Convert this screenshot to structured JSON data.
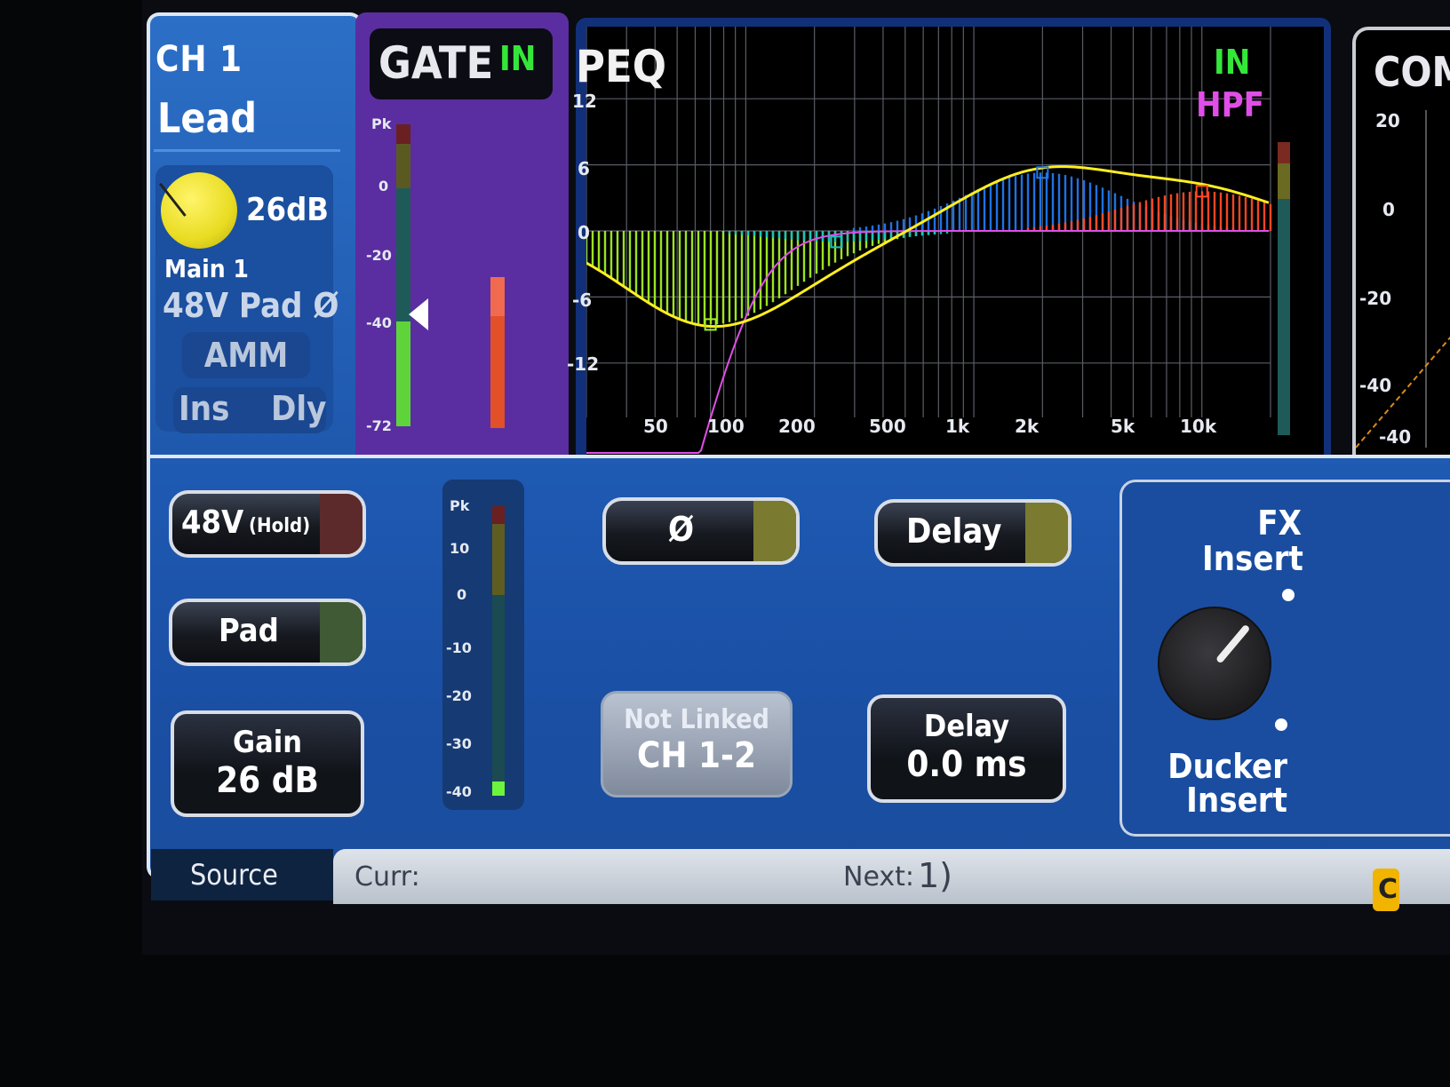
{
  "channel": {
    "id": "CH 1",
    "name": "Lead",
    "gain_readout": "26dB",
    "output": "Main 1",
    "flags": "48V Pad Ø",
    "amm_label": "AMM",
    "ins_label": "Ins",
    "dly_label": "Dly"
  },
  "gate": {
    "title": "GATE",
    "status": "IN",
    "scale": [
      "Pk",
      "0",
      "-20",
      "-40",
      "-72"
    ]
  },
  "peq": {
    "title": "PEQ",
    "status": "IN",
    "hpf_label": "HPF",
    "y_ticks": [
      "12",
      "6",
      "0",
      "-6",
      "-12"
    ],
    "x_ticks": [
      "50",
      "100",
      "200",
      "500",
      "1k",
      "2k",
      "5k",
      "10k"
    ],
    "x_tick_freqs": [
      50,
      100,
      200,
      500,
      1000,
      2000,
      5000,
      10000
    ],
    "band_colors": {
      "band1": "#a4ef23",
      "band2": "#11c6c2",
      "band3": "#1f79f0",
      "band4": "#ff4a25",
      "curve": "#ffee22",
      "hpf": "#e04ee8"
    }
  },
  "comp": {
    "title": "COM",
    "scale": [
      "20",
      "0",
      "-20",
      "-40",
      "-40"
    ]
  },
  "preamp": {
    "phantom_label": "48V",
    "phantom_hint": "(Hold)",
    "pad_label": "Pad",
    "gain_title": "Gain",
    "gain_value": "26 dB",
    "meter_scale": [
      "Pk",
      "10",
      "0",
      "-10",
      "-20",
      "-30",
      "-40"
    ]
  },
  "controls": {
    "polarity_label": "Ø",
    "delay_toggle_label": "Delay",
    "link_status": "Not Linked",
    "link_pair": "CH 1-2",
    "delay_title": "Delay",
    "delay_value": "0.0 ms"
  },
  "insert": {
    "fx_line1": "FX",
    "fx_line2": "Insert",
    "ducker_line1": "Ducker",
    "ducker_line2": "Insert"
  },
  "footer": {
    "tab_label": "Source",
    "curr_label": "Curr:",
    "next_label": "Next:",
    "next_value": "1)",
    "edge_button": "C"
  }
}
